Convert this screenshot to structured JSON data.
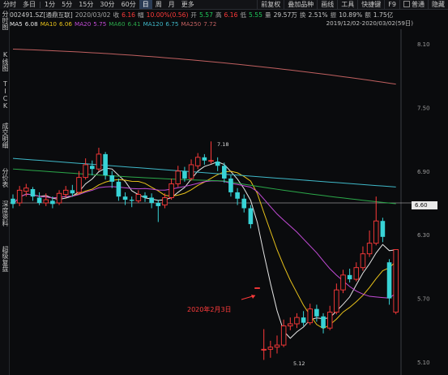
{
  "toolbar": {
    "left": [
      "分时",
      "多日",
      "1分",
      "5分",
      "15分",
      "30分",
      "60分",
      "日",
      "周",
      "月",
      "更多"
    ],
    "active": "日",
    "right": [
      "前复权",
      "叠加品种",
      "画线",
      "工具",
      "快捷键",
      "F9",
      "普通",
      "隐藏"
    ]
  },
  "info": {
    "code_name": "002491.SZ[通鼎互联]",
    "date": "2020/03/02",
    "close_label": "收",
    "close_value": "6.16",
    "change_label": "幅",
    "change_value": "10.00%(0.56)",
    "open_label": "开",
    "open_value": "5.57",
    "high_label": "高",
    "high_value": "6.16",
    "low_label": "低",
    "low_value": "5.55",
    "volume_label": "量",
    "volume_value": "29.57万",
    "turnover_label": "换",
    "turnover_value": "2.51%",
    "amplitude_label": "振",
    "amplitude_value": "10.89%",
    "amount_label": "额",
    "amount_value": "1.75亿"
  },
  "ma": {
    "ma5_label": "MA5",
    "ma5_value": "6.08",
    "ma10_label": "MA10",
    "ma10_value": "6.06",
    "ma20_label": "MA20",
    "ma20_value": "5.75",
    "ma60_label": "MA60",
    "ma60_value": "6.41",
    "ma120_label": "MA120",
    "ma120_value": "6.75",
    "ma250_label": "MA250",
    "ma250_value": "7.72",
    "date_range": "2019/12/02-2020/03/02(59日)"
  },
  "left_tabs": [
    "分时图",
    "K线图",
    "TICK",
    "成交明细",
    "分价表",
    "深度资料",
    "超级复盘"
  ],
  "price_axis": [
    "8.10",
    "7.50",
    "6.90",
    "6.30",
    "5.70",
    "5.10"
  ],
  "current_price_tag": "6.60",
  "annotations": {
    "event_text": "2020年2月3日",
    "high_marker": "7.18",
    "low_marker": "5.12"
  },
  "colors": {
    "up": "#ff3a3a",
    "down": "#38d3d6",
    "ma5": "#e6e6e6",
    "ma10": "#e8c21a",
    "ma20": "#c24bd6",
    "ma60": "#2ba84a",
    "ma120": "#3fb8c8",
    "ma250": "#c06060"
  },
  "candles": [
    [
      6.64,
      6.59,
      6.68,
      6.55
    ],
    [
      6.6,
      6.72,
      6.76,
      6.57
    ],
    [
      6.71,
      6.74,
      6.78,
      6.66
    ],
    [
      6.73,
      6.66,
      6.75,
      6.62
    ],
    [
      6.65,
      6.6,
      6.7,
      6.58
    ],
    [
      6.6,
      6.63,
      6.69,
      6.57
    ],
    [
      6.62,
      6.59,
      6.66,
      6.55
    ],
    [
      6.6,
      6.69,
      6.72,
      6.58
    ],
    [
      6.68,
      6.72,
      6.76,
      6.65
    ],
    [
      6.72,
      6.69,
      6.77,
      6.66
    ],
    [
      6.7,
      6.84,
      6.9,
      6.68
    ],
    [
      6.84,
      6.96,
      7.02,
      6.82
    ],
    [
      6.95,
      6.92,
      7.0,
      6.86
    ],
    [
      6.92,
      7.06,
      7.12,
      6.9
    ],
    [
      7.06,
      6.86,
      7.08,
      6.82
    ],
    [
      6.86,
      6.8,
      6.9,
      6.74
    ],
    [
      6.8,
      6.66,
      6.83,
      6.62
    ],
    [
      6.66,
      6.63,
      6.7,
      6.58
    ],
    [
      6.63,
      6.62,
      6.66,
      6.56
    ],
    [
      6.62,
      6.68,
      6.72,
      6.6
    ],
    [
      6.67,
      6.65,
      6.7,
      6.61
    ],
    [
      6.65,
      6.6,
      6.69,
      6.55
    ],
    [
      6.6,
      6.57,
      6.63,
      6.42
    ],
    [
      6.58,
      6.65,
      6.69,
      6.55
    ],
    [
      6.65,
      6.78,
      6.83,
      6.63
    ],
    [
      6.78,
      6.9,
      6.95,
      6.75
    ],
    [
      6.9,
      6.83,
      6.94,
      6.8
    ],
    [
      6.83,
      6.96,
      7.01,
      6.81
    ],
    [
      6.95,
      7.03,
      7.07,
      6.92
    ],
    [
      7.03,
      7.0,
      7.06,
      6.96
    ],
    [
      7.0,
      7.0,
      7.18,
      6.97
    ],
    [
      6.99,
      6.95,
      7.03,
      6.9
    ],
    [
      6.95,
      6.83,
      6.98,
      6.79
    ],
    [
      6.83,
      6.7,
      6.86,
      6.66
    ],
    [
      6.7,
      6.64,
      6.74,
      6.58
    ],
    [
      6.64,
      6.55,
      6.68,
      6.51
    ],
    [
      6.55,
      6.4,
      6.58,
      6.36
    ],
    [
      5.8,
      5.8,
      5.8,
      5.8
    ],
    [
      5.22,
      5.22,
      5.41,
      5.12
    ],
    [
      5.22,
      5.24,
      5.3,
      5.14
    ],
    [
      5.24,
      5.26,
      5.35,
      5.18
    ],
    [
      5.26,
      5.44,
      5.5,
      5.24
    ],
    [
      5.44,
      5.46,
      5.52,
      5.4
    ],
    [
      5.46,
      5.52,
      5.56,
      5.42
    ],
    [
      5.52,
      5.47,
      5.58,
      5.44
    ],
    [
      5.47,
      5.6,
      5.65,
      5.45
    ],
    [
      5.6,
      5.53,
      5.64,
      5.48
    ],
    [
      5.53,
      5.42,
      5.56,
      5.37
    ],
    [
      5.42,
      5.57,
      5.63,
      5.4
    ],
    [
      5.57,
      5.78,
      5.84,
      5.55
    ],
    [
      5.78,
      5.92,
      5.97,
      5.75
    ],
    [
      5.92,
      5.88,
      5.98,
      5.85
    ],
    [
      5.88,
      5.99,
      6.04,
      5.86
    ],
    [
      5.99,
      6.12,
      6.19,
      5.96
    ],
    [
      6.12,
      6.22,
      6.34,
      6.09
    ],
    [
      6.22,
      6.43,
      6.66,
      6.2
    ],
    [
      6.43,
      6.28,
      6.46,
      6.23
    ],
    [
      6.04,
      5.7,
      6.07,
      5.64
    ],
    [
      5.57,
      6.16,
      6.16,
      5.55
    ]
  ]
}
